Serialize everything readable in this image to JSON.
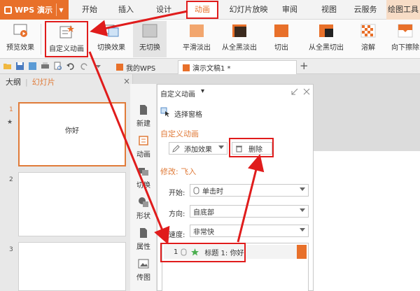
{
  "menubar": {
    "app_name": "WPS 演示",
    "tabs": [
      "开始",
      "插入",
      "设计",
      "动画",
      "幻灯片放映",
      "审阅",
      "视图",
      "云服务",
      "绘图工具"
    ],
    "active_tab": "动画"
  },
  "ribbon": {
    "buttons": [
      "预览效果",
      "自定义动画",
      "切换效果",
      "无切换",
      "平滑淡出",
      "从全黑淡出",
      "切出",
      "从全黑切出",
      "溶解",
      "向下擦除"
    ]
  },
  "tabbar": {
    "home_tab": "我的WPS",
    "doc_tab": "演示文稿1 *",
    "add_label": "+"
  },
  "left_panel": {
    "tab_outline": "大纲",
    "tab_slides": "幻灯片",
    "close_label": "×",
    "slides": [
      {
        "number": "1",
        "text": "你好",
        "star": "★"
      },
      {
        "number": "2",
        "text": ""
      },
      {
        "number": "3",
        "text": ""
      }
    ]
  },
  "side_buttons": [
    "新建",
    "动画",
    "切换",
    "形状",
    "属性",
    "传图"
  ],
  "task_pane": {
    "title": "自定义动画",
    "title_arrow": "▾",
    "select_pane": "选择窗格",
    "section_title": "自定义动画",
    "add_effect": "添加效果",
    "delete": "删除",
    "modify_title": "修改: 飞入",
    "start_label": "开始:",
    "start_value": "单击时",
    "direction_label": "方向:",
    "direction_value": "自底部",
    "speed_label": "速度:",
    "speed_value": "非常快",
    "effect_item": {
      "index": "1",
      "label": "标题 1: 你好"
    }
  },
  "colors": {
    "accent": "#e8702a",
    "highlight_red": "#e01c1c",
    "section_orange": "#e07b39"
  }
}
